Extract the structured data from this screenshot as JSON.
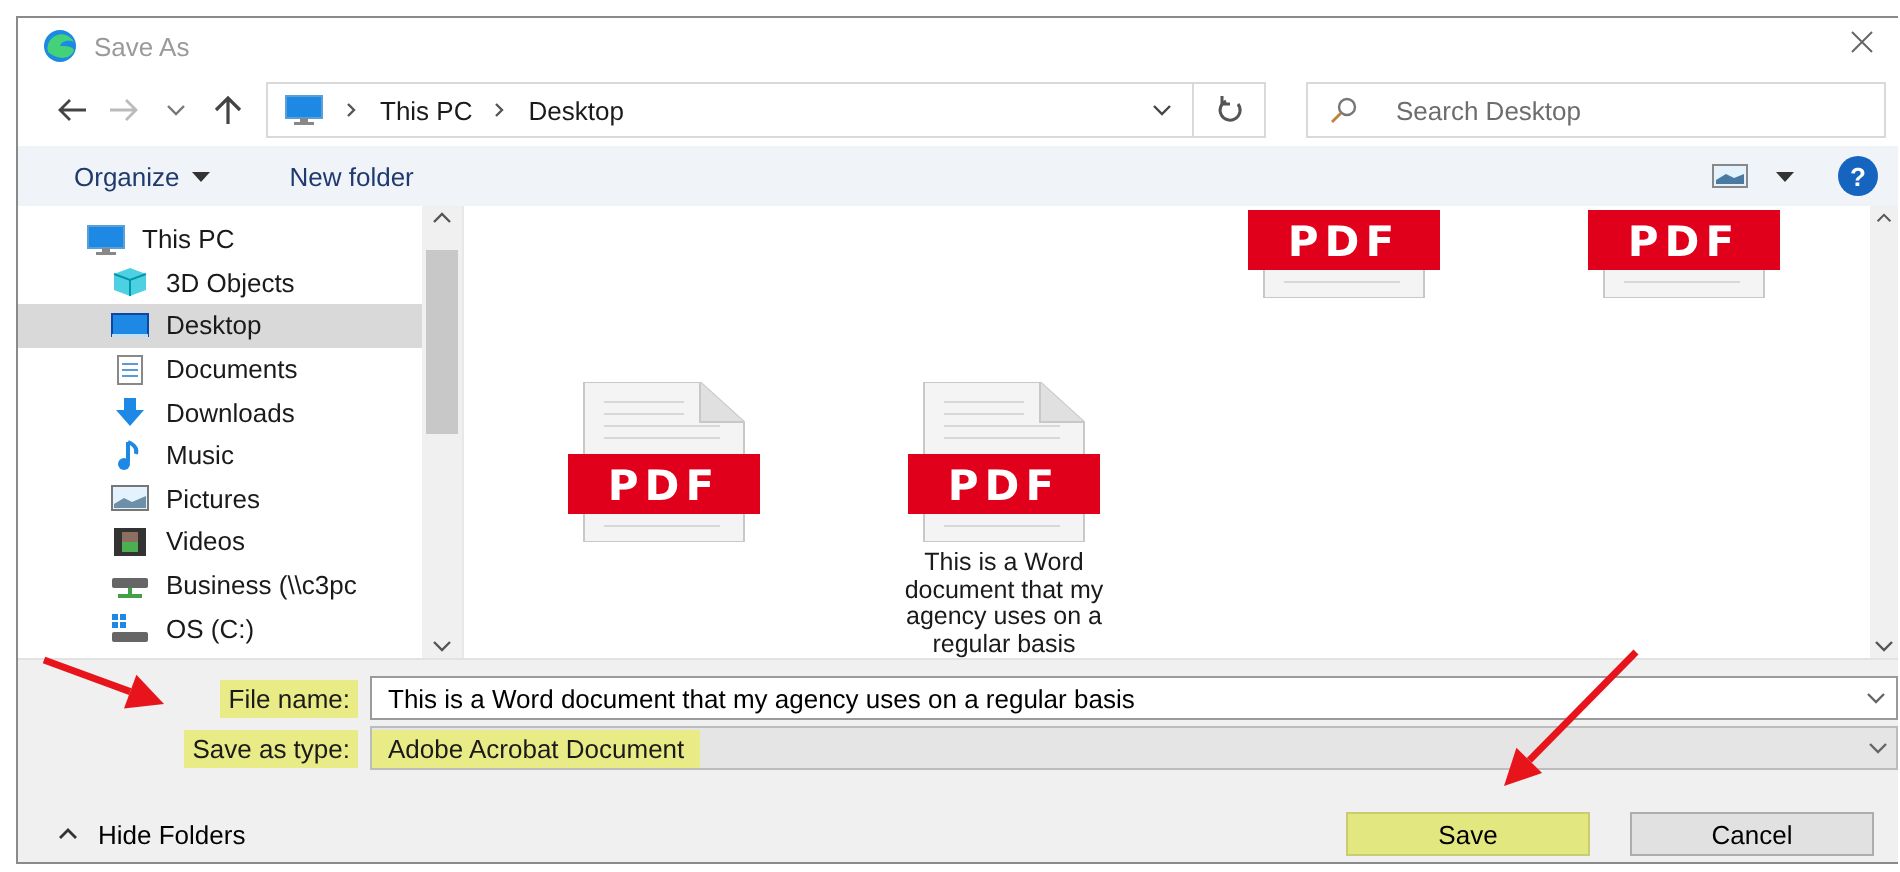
{
  "window": {
    "title": "Save As"
  },
  "nav": {
    "breadcrumb": [
      "This PC",
      "Desktop"
    ],
    "search": {
      "placeholder": "Search Desktop"
    }
  },
  "toolbar": {
    "organize": "Organize",
    "new_folder": "New folder",
    "help": "?"
  },
  "sidebar": {
    "items": [
      {
        "label": "This PC",
        "selected": false,
        "children": [
          {
            "label": "3D Objects",
            "selected": false
          },
          {
            "label": "Desktop",
            "selected": true
          },
          {
            "label": "Documents",
            "selected": false
          },
          {
            "label": "Downloads",
            "selected": false
          },
          {
            "label": "Music",
            "selected": false
          },
          {
            "label": "Pictures",
            "selected": false
          },
          {
            "label": "Videos",
            "selected": false
          },
          {
            "label": "Business (\\\\c3pc",
            "selected": false
          },
          {
            "label": "OS (C:)",
            "selected": false
          }
        ]
      }
    ]
  },
  "files": {
    "rows": [
      [
        {
          "badge": "PDF",
          "partial": true
        },
        {
          "badge": "PDF",
          "partial": true
        }
      ],
      [
        {
          "badge": "PDF",
          "partial": false
        },
        {
          "badge": "PDF",
          "partial": false,
          "name": "This is a Word document that my agency uses on a regular basis"
        }
      ]
    ]
  },
  "form": {
    "file_name": {
      "label": "File name:",
      "value": "This is a Word document that my agency uses on a regular basis",
      "label_highlighted": true
    },
    "save_as_type": {
      "label": "Save as type:",
      "value": "Adobe Acrobat Document",
      "highlighted": true,
      "label_highlighted": true
    }
  },
  "footer": {
    "hide_folders": "Hide Folders",
    "buttons": [
      {
        "label": "Save",
        "highlighted": true
      },
      {
        "label": "Cancel",
        "highlighted": false
      }
    ]
  },
  "annotations": [
    {
      "kind": "arrow"
    },
    {
      "kind": "arrow"
    }
  ]
}
